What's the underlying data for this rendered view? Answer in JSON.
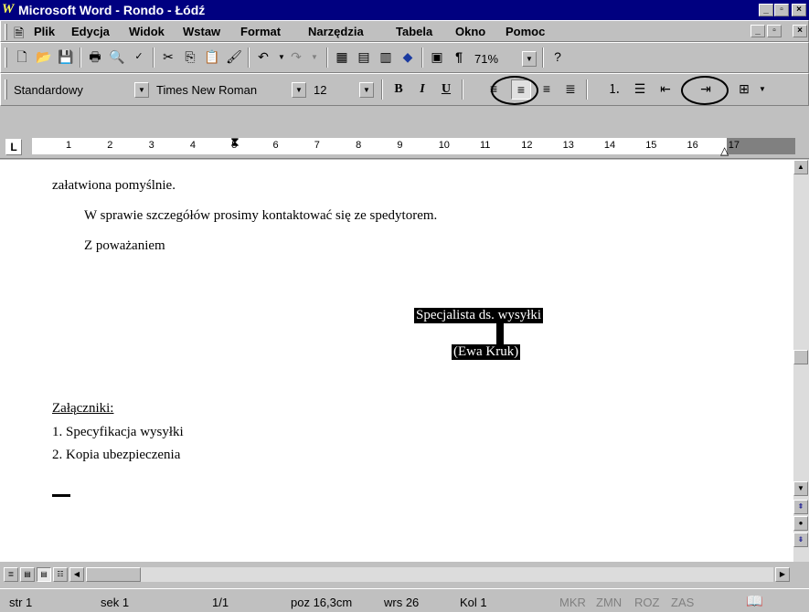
{
  "window": {
    "title": "Microsoft Word - Rondo - Łódź"
  },
  "menu": {
    "items": [
      "Plik",
      "Edycja",
      "Widok",
      "Wstaw",
      "Format",
      "Narzędzia",
      "Tabela",
      "Okno",
      "Pomoc"
    ]
  },
  "toolbar_standard": {
    "zoom": "71%"
  },
  "toolbar_format": {
    "style": "Standardowy",
    "font": "Times New Roman",
    "size": "12",
    "bold": "B",
    "italic": "I",
    "underline": "U"
  },
  "ruler": {
    "numbers": [
      "1",
      "2",
      "3",
      "4",
      "5",
      "6",
      "7",
      "8",
      "9",
      "10",
      "11",
      "12",
      "13",
      "14",
      "15",
      "16",
      "17"
    ]
  },
  "document": {
    "line1": "załatwiona pomyślnie.",
    "line2": "W sprawie szczegółów prosimy kontaktować się ze spedytorem.",
    "line3": "Z poważaniem",
    "signature_title": "Specjalista ds. wysyłki",
    "signature_name": "(Ewa Kruk)",
    "attachments_heading": "Załączniki:",
    "attachments": [
      "1.  Specyfikacja wysyłki",
      "2.  Kopia ubezpieczenia"
    ]
  },
  "status": {
    "page": "str 1",
    "section": "sek 1",
    "pages": "1/1",
    "position": "poz 16,3cm",
    "line": "wrs 26",
    "column": "Kol 1",
    "rec": "MKR",
    "trk": "ZMN",
    "ext": "ROZ",
    "ovr": "ZAS"
  },
  "colors": {
    "titlebar": "#000080",
    "chrome": "#c0c0c0",
    "page": "#ffffff",
    "highlight": "#000000"
  }
}
